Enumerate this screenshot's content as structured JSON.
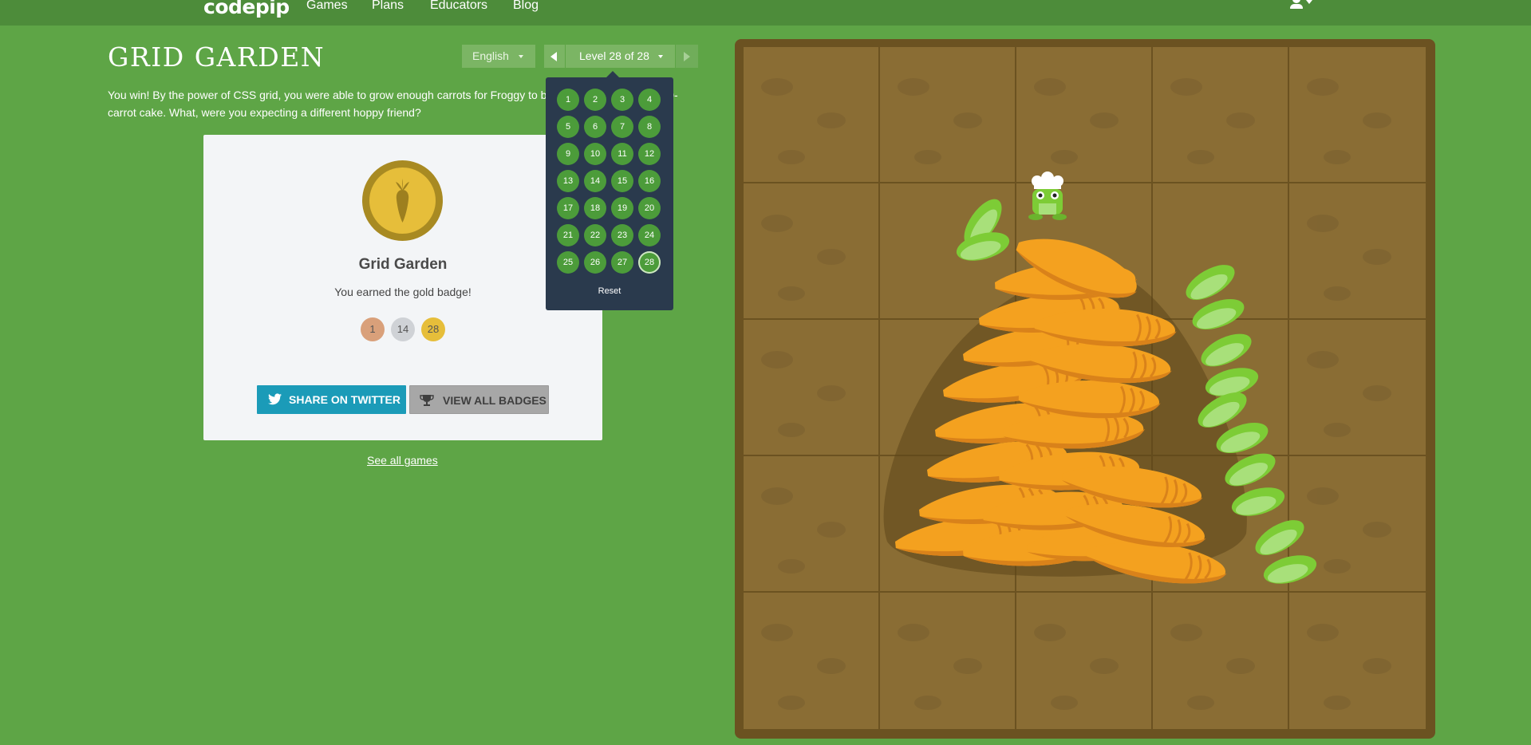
{
  "nav": {
    "logo": "codepip",
    "links": [
      "Games",
      "Plans",
      "Educators",
      "Blog"
    ]
  },
  "game": {
    "title": "GRID GARDEN",
    "language": "English",
    "level_label": "Level 28 of 28",
    "win_message": "You win! By the power of CSS grid, you were able to grow enough carrots for Froggy to bake his world-famous 120-carrot cake. What, were you expecting a different hoppy friend?"
  },
  "badge_card": {
    "title": "Grid Garden",
    "subtitle": "You earned the gold badge!",
    "badges": [
      {
        "label": "1",
        "color": "#d9a07a"
      },
      {
        "label": "14",
        "color": "#cfd2d6"
      },
      {
        "label": "28",
        "color": "#e6be3a"
      }
    ],
    "share_label": "SHARE ON TWITTER",
    "view_badges_label": "VIEW ALL BADGES",
    "see_all_label": "See all games"
  },
  "level_menu": {
    "levels": [
      "1",
      "2",
      "3",
      "4",
      "5",
      "6",
      "7",
      "8",
      "9",
      "10",
      "11",
      "12",
      "13",
      "14",
      "15",
      "16",
      "17",
      "18",
      "19",
      "20",
      "21",
      "22",
      "23",
      "24",
      "25",
      "26",
      "27",
      "28"
    ],
    "current": "28",
    "reset_label": "Reset"
  },
  "colors": {
    "background": "#5ea546",
    "nav": "#4d8c3a",
    "soil": "#8a6d34",
    "frame": "#6b5221",
    "carrot": "#f4a11f",
    "leaf": "#7dcc36",
    "twitter": "#1b9bb8"
  },
  "icons": {
    "user": "user-icon",
    "twitter": "twitter-icon",
    "trophy": "trophy-icon",
    "medal": "carrot-medal-icon"
  }
}
